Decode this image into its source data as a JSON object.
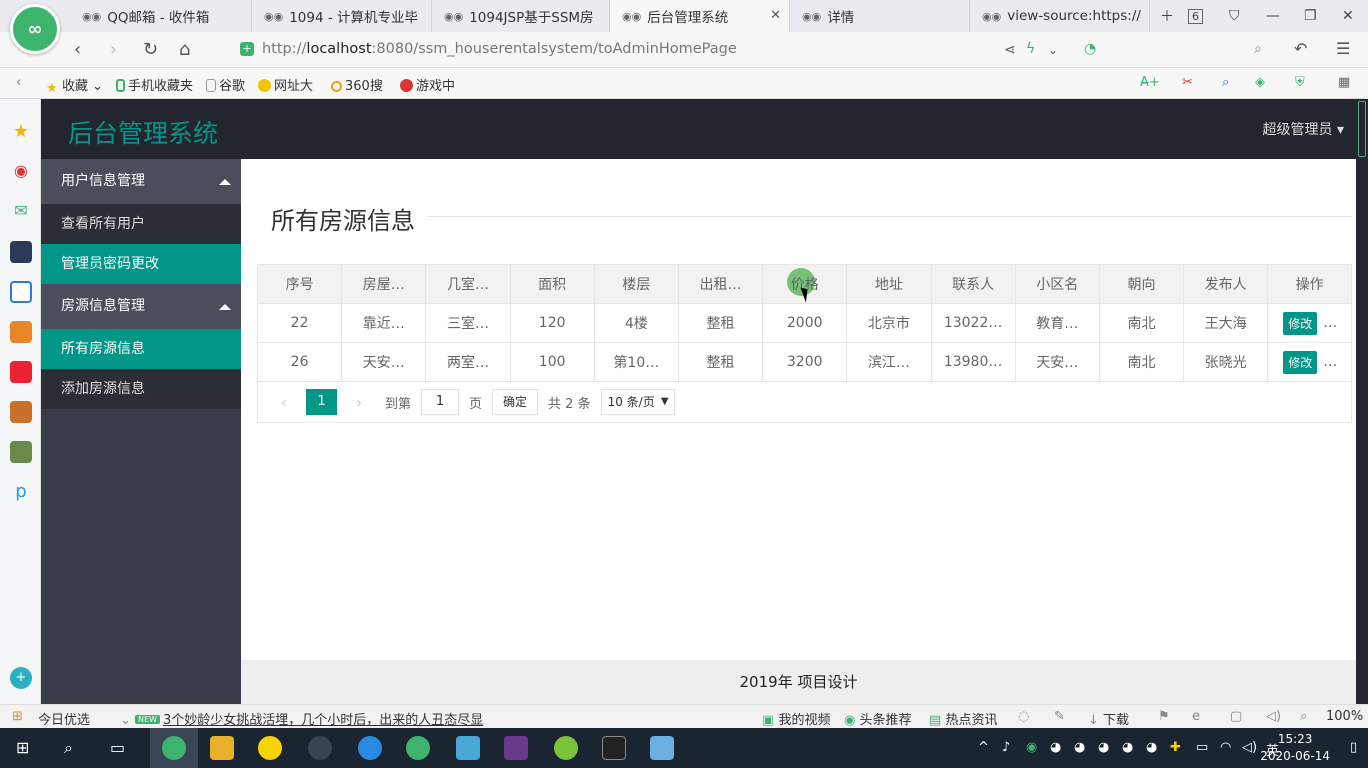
{
  "browser": {
    "tabs": [
      {
        "title": "QQ邮箱 - 收件箱"
      },
      {
        "title": "1094 - 计算机专业毕"
      },
      {
        "title": "1094JSP基于SSM房"
      },
      {
        "title": "后台管理系统"
      },
      {
        "title": "详情"
      },
      {
        "title": "view-source:https://"
      }
    ],
    "tab_count": "6",
    "url_prefix": "http://",
    "url_host": "localhost",
    "url_rest": ":8080/ssm_houserentalsystem/toAdminHomePage",
    "bookmarks": [
      "收藏",
      "手机收藏夹",
      "谷歌",
      "网址大",
      "360搜",
      "游戏中"
    ]
  },
  "app": {
    "title": "后台管理系统",
    "admin_label": "超级管理员",
    "accent": "#009688"
  },
  "sidebar": {
    "groups": [
      {
        "label": "用户信息管理",
        "items": [
          {
            "label": "查看所有用户"
          },
          {
            "label": "管理员密码更改"
          }
        ]
      },
      {
        "label": "房源信息管理",
        "items": [
          {
            "label": "所有房源信息"
          },
          {
            "label": "添加房源信息"
          }
        ]
      }
    ]
  },
  "main": {
    "page_title": "所有房源信息",
    "columns": [
      "序号",
      "房屋…",
      "几室…",
      "面积",
      "楼层",
      "出租…",
      "价格",
      "地址",
      "联系人",
      "小区名",
      "朝向",
      "发布人",
      "操作"
    ],
    "rows": [
      {
        "id": "22",
        "title": "靠近…",
        "rooms": "三室…",
        "area": "120",
        "floor": "4楼",
        "rent_type": "整租",
        "price": "2000",
        "address": "北京市",
        "contact": "13022…",
        "community": "教育…",
        "orientation": "南北",
        "publisher": "王大海",
        "action": "修改",
        "more": "…"
      },
      {
        "id": "26",
        "title": "天安…",
        "rooms": "两室…",
        "area": "100",
        "floor": "第10…",
        "rent_type": "整租",
        "price": "3200",
        "address": "滨江…",
        "contact": "13980…",
        "community": "天安…",
        "orientation": "南北",
        "publisher": "张晓光",
        "action": "修改",
        "more": "…"
      }
    ],
    "pager": {
      "current": "1",
      "goto_label": "到第",
      "goto_value": "1",
      "page_unit": "页",
      "confirm": "确定",
      "total": "共 2 条",
      "page_size": "10 条/页"
    }
  },
  "footer": {
    "text": "2019年 项目设计"
  },
  "statusbar": {
    "today": "今日优选",
    "new_badge": "NEW",
    "news": "3个妙龄少女挑战活埋，几个小时后，出来的人丑态尽显",
    "my_video": "我的视频",
    "headline": "头条推荐",
    "hot": "热点资讯",
    "download": "下载",
    "zoom": "100%"
  },
  "taskbar": {
    "time": "15:23",
    "date": "2020-06-14",
    "ime": "英"
  }
}
